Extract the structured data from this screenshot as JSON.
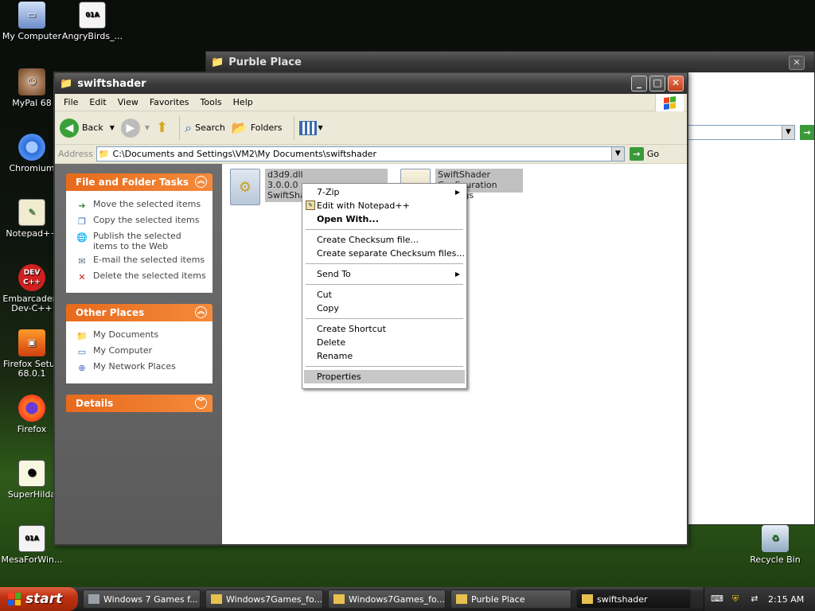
{
  "desktop": {
    "icons": [
      {
        "label": "My Computer",
        "icon": "computer-icon"
      },
      {
        "label": "AngryBirds_...",
        "icon": "exe-icon"
      },
      {
        "label": "MyPal 68",
        "icon": "mypal-icon"
      },
      {
        "label": "Chromium",
        "icon": "chromium-icon"
      },
      {
        "label": "Notepad++",
        "icon": "notepadpp-icon"
      },
      {
        "label": "Embarcadero Dev-C++",
        "icon": "devcpp-icon"
      },
      {
        "label": "Firefox Setup 68.0.1",
        "icon": "firefox-setup-icon"
      },
      {
        "label": "Firefox",
        "icon": "firefox-icon"
      },
      {
        "label": "SuperHilda",
        "icon": "superhilda-icon"
      },
      {
        "label": "MesaForWin...",
        "icon": "exe-icon"
      },
      {
        "label": "Recycle Bin",
        "icon": "recycle-bin-icon"
      }
    ],
    "devcpp_badge": "DEV C++",
    "exe_badge": "01A"
  },
  "bg_window": {
    "title": "Purble Place"
  },
  "window": {
    "title": "swiftshader",
    "menu": [
      "File",
      "Edit",
      "View",
      "Favorites",
      "Tools",
      "Help"
    ],
    "toolbar": {
      "back": "Back",
      "search": "Search",
      "folders": "Folders"
    },
    "address": {
      "label": "Address",
      "path": "C:\\Documents and Settings\\VM2\\My Documents\\swiftshader",
      "go": "Go"
    },
    "panels": [
      {
        "title": "File and Folder Tasks",
        "items": [
          "Move the selected items",
          "Copy the selected items",
          "Publish the selected items to the Web",
          "E-mail the selected items",
          "Delete the selected items"
        ]
      },
      {
        "title": "Other Places",
        "items": [
          "My Documents",
          "My Computer",
          "My Network Places"
        ]
      },
      {
        "title": "Details",
        "items": []
      }
    ],
    "files": [
      {
        "name": "d3d9.dll",
        "version": "3.0.0.0",
        "desc": "SwiftSha"
      },
      {
        "name": "SwiftShader",
        "version": "",
        "desc": "Configuration Settings"
      }
    ]
  },
  "context_menu": {
    "items": [
      {
        "label": "7-Zip",
        "submenu": true
      },
      {
        "label": "Edit with Notepad++"
      },
      {
        "label": "Open With...",
        "bold": true
      },
      {
        "sep": true
      },
      {
        "label": "Create Checksum file..."
      },
      {
        "label": "Create separate Checksum files..."
      },
      {
        "sep": true
      },
      {
        "label": "Send To",
        "submenu": true
      },
      {
        "sep": true
      },
      {
        "label": "Cut"
      },
      {
        "label": "Copy"
      },
      {
        "sep": true
      },
      {
        "label": "Create Shortcut"
      },
      {
        "label": "Delete"
      },
      {
        "label": "Rename"
      },
      {
        "sep": true
      },
      {
        "label": "Properties",
        "selected": true
      }
    ]
  },
  "taskbar": {
    "start": "start",
    "tasks": [
      "Windows 7 Games f...",
      "Windows7Games_fo...",
      "Windows7Games_fo...",
      "Purble Place",
      "swiftshader"
    ],
    "clock": "2:15 AM"
  }
}
